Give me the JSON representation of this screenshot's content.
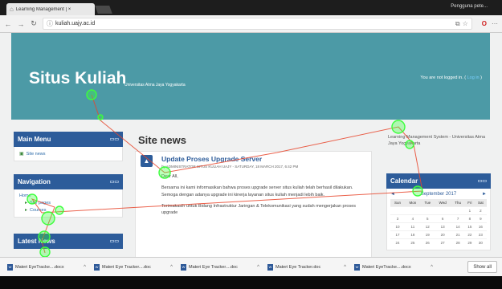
{
  "browser": {
    "tab_title": "Learning Management | ×",
    "user_label": "Pengguna pete...",
    "url": "kuliah.uajy.ac.id",
    "icons": [
      "back-icon",
      "forward-icon",
      "reload-icon",
      "info-icon",
      "translate-icon",
      "star-icon",
      "opera-icon",
      "menu-icon"
    ]
  },
  "banner": {
    "site_title": "Situs Kuliah",
    "subtitle": "Universitas Atma Jaya Yogyakarta",
    "login_text": "You are not logged in. (",
    "login_link": "Log in",
    "login_close": ")"
  },
  "main_menu": {
    "title": "Main Menu",
    "items": [
      {
        "label": "Site news",
        "icon": "news-icon"
      }
    ]
  },
  "navigation": {
    "title": "Navigation",
    "items": [
      {
        "label": "Home",
        "icon": ""
      },
      {
        "label": "Site pages",
        "icon": "triangle-icon"
      },
      {
        "label": "Courses",
        "icon": "triangle-icon"
      }
    ]
  },
  "latest_news": {
    "title": "Latest News"
  },
  "center": {
    "section_title": "Site news",
    "post": {
      "title": "Update Proses Upgrade Server",
      "author": "by ADMINISTRATOR SITUS KULIAH UAJY - SATURDAY, 18 MARCH 2017, 6:42 PM",
      "greeting": "Dear All,",
      "paragraph1": "Bersama ini kami informasikan bahwa proses upgrade server situs kuliah telah berhasil dilakukan. Semoga dengan adanya upgrade ini kinerja layanan situs kuliah menjadi lebih baik.",
      "paragraph2": "Terimakasih untuk Bidang Infrastruktur Jaringan & Telekomunikasi yang sudah mengerjakan proses upgrade"
    }
  },
  "right": {
    "info": "Learning Management System - Universitas Atma Jaya Yogyakarta",
    "calendar": {
      "title": "Calendar",
      "prev": "◄",
      "next": "►",
      "month": "September 2017",
      "days": [
        "Sun",
        "Mon",
        "Tue",
        "Wed",
        "Thu",
        "Fri",
        "Sat"
      ],
      "weeks": [
        [
          "",
          "",
          "",
          "",
          "",
          "1",
          "2"
        ],
        [
          "3",
          "4",
          "5",
          "6",
          "7",
          "8",
          "9"
        ],
        [
          "10",
          "11",
          "12",
          "13",
          "14",
          "15",
          "16"
        ],
        [
          "17",
          "18",
          "19",
          "20",
          "21",
          "22",
          "23"
        ],
        [
          "24",
          "25",
          "26",
          "27",
          "28",
          "29",
          "30"
        ]
      ]
    }
  },
  "downloads": {
    "items": [
      {
        "name": "Materi EyeTracke....docx"
      },
      {
        "name": "Materi Eye Tracker....doc"
      },
      {
        "name": "Materi Eye Tracker....doc"
      },
      {
        "name": "Materi Eye Tracker.doc"
      },
      {
        "name": "Materi EyeTracke....docx"
      }
    ],
    "show_all": "Show all"
  },
  "colors": {
    "banner": "#4c9aa6",
    "block_header": "#2d5c9a",
    "gaze_point": "#3cff3c",
    "gaze_line": "#e8452c"
  }
}
